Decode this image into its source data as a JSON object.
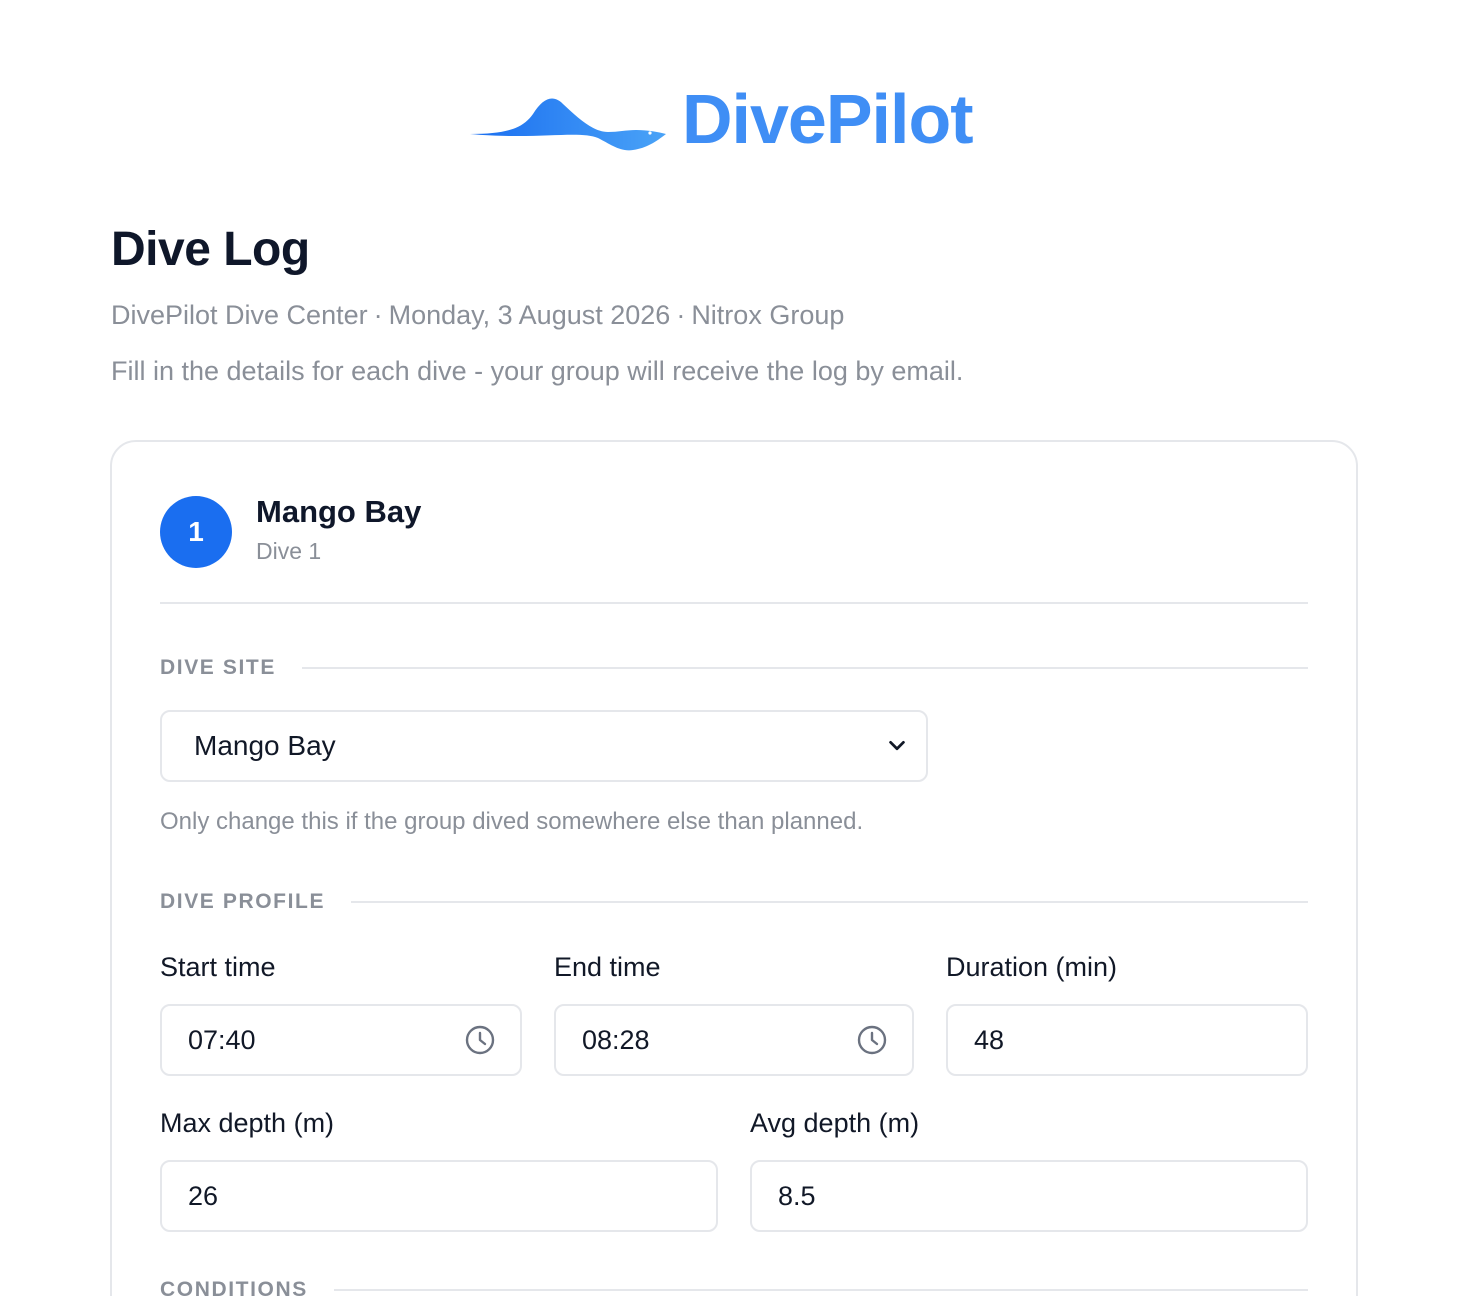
{
  "brand": {
    "name": "DivePilot",
    "colors": {
      "start": "#1a6ef0",
      "end": "#4aa3f7"
    }
  },
  "header": {
    "title": "Dive Log",
    "center": "DivePilot Dive Center",
    "date": "Monday, 3 August 2026",
    "group": "Nitrox Group",
    "separator": "·",
    "intro": "Fill in the details for each dive - your group will receive the log by email."
  },
  "dive": {
    "number": "1",
    "name": "Mango Bay",
    "subtitle": "Dive 1",
    "accent": "#1a6ef0"
  },
  "sections": {
    "site": "DIVE SITE",
    "profile": "DIVE PROFILE",
    "conditions": "CONDITIONS"
  },
  "site": {
    "selected": "Mango Bay",
    "hint": "Only change this if the group dived somewhere else than planned."
  },
  "profile": {
    "start_time": {
      "label": "Start time",
      "value": "07:40",
      "icon": "clock-icon"
    },
    "end_time": {
      "label": "End time",
      "value": "08:28",
      "icon": "clock-icon"
    },
    "duration": {
      "label": "Duration (min)",
      "value": "48"
    },
    "max_depth": {
      "label": "Max depth (m)",
      "value": "26"
    },
    "avg_depth": {
      "label": "Avg depth (m)",
      "value": "8.5"
    }
  }
}
